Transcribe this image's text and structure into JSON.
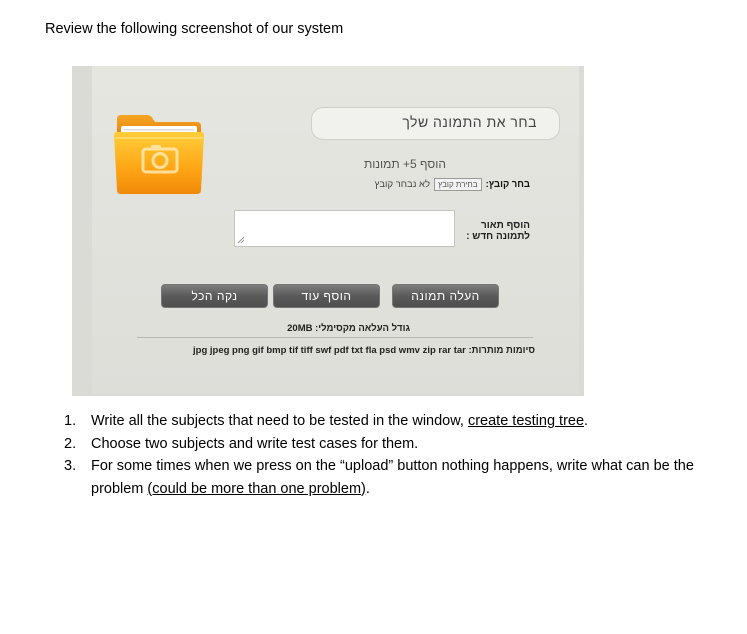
{
  "intro_text": "Review the following screenshot of our system",
  "screenshot": {
    "choose_image_title": "בחר את התמונה שלך",
    "add_five_images": "הוסף 5+ תמונות",
    "choose_file_label": "בחר קובץ:",
    "browse_button": "בחירת קובץ",
    "no_file_chosen": "לא נבחר קובץ",
    "add_description_label": "הוסף תאור לתמונה חדש :",
    "upload_button": "העלה תמונה",
    "add_more_button": "הוסף עוד",
    "clear_all_button": "נקה הכל",
    "max_size_label": "גודל העלאה מקסימלי:",
    "max_size_value": "20MB",
    "allowed_types_label": "סיומות מותרות:",
    "allowed_types_value": "jpg jpeg png gif bmp tif tiff swf pdf txt fla psd wmv zip rar tar"
  },
  "questions": [
    {
      "number": "1.",
      "text": "Write all the subjects that need to be tested in the window, ",
      "underlined": "create testing tree",
      "after": "."
    },
    {
      "number": "2.",
      "text": "Choose two subjects and write test cases for them.",
      "underlined": "",
      "after": ""
    },
    {
      "number": "3.",
      "text": "For some times when we press on the “upload” button nothing happens, write what can be the problem ",
      "underlined": "(could be more than one problem)",
      "after": "."
    }
  ]
}
